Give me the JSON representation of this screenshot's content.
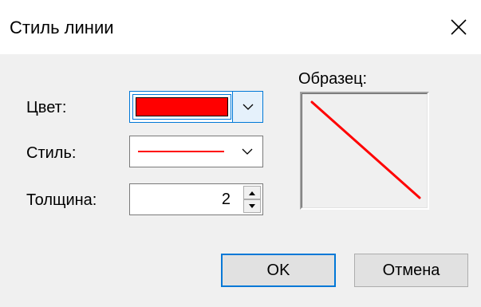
{
  "window": {
    "title": "Стиль линии",
    "close_icon": "close-icon"
  },
  "form": {
    "color_label": "Цвет:",
    "color_value": "#ff0000",
    "style_label": "Стиль:",
    "style_value": "solid",
    "thickness_label": "Толщина:",
    "thickness_value": "2"
  },
  "sample": {
    "label": "Образец:",
    "line_color": "#ff0000"
  },
  "buttons": {
    "ok_label": "OK",
    "cancel_label": "Отмена"
  },
  "colors": {
    "accent": "#0078d7",
    "content_bg": "#f0f0f0"
  }
}
